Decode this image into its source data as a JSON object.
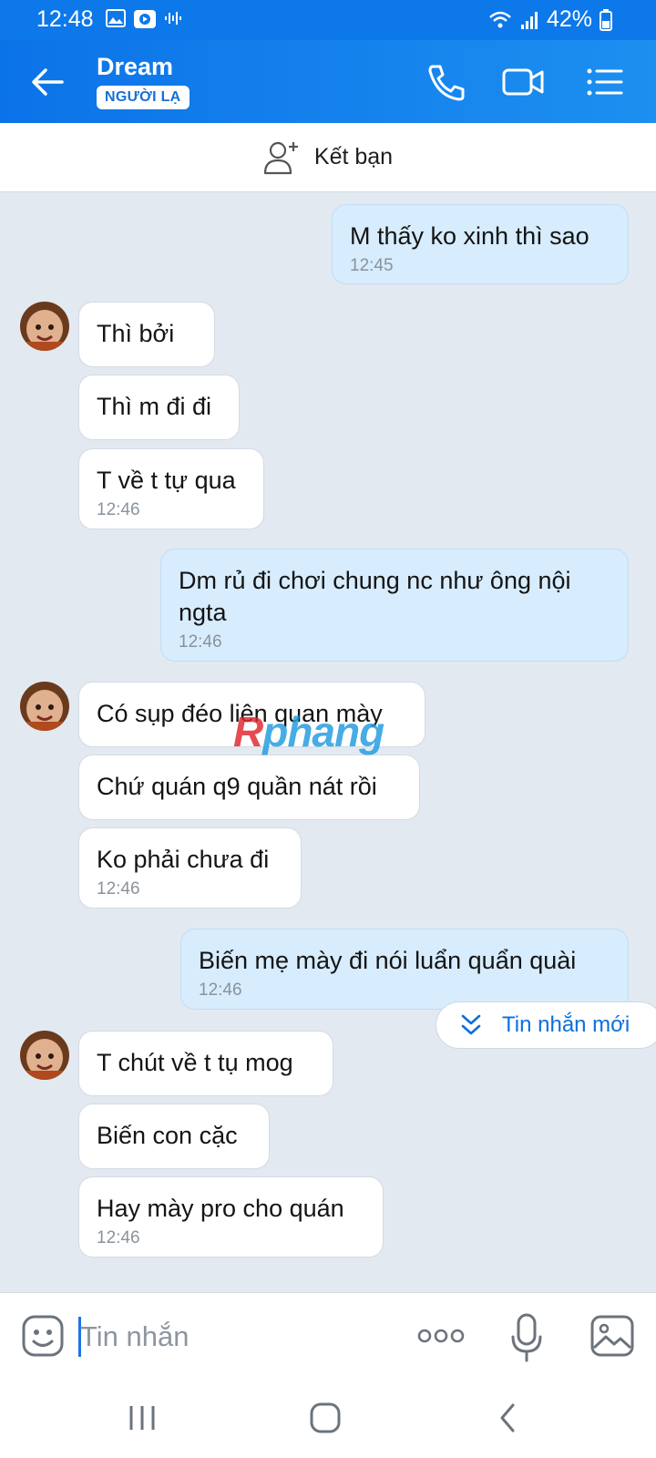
{
  "status": {
    "time": "12:48",
    "battery": "42%"
  },
  "header": {
    "name": "Dream",
    "badge": "NGƯỜI LẠ"
  },
  "add_friend": {
    "label": "Kết bạn"
  },
  "watermark": {
    "part1": "R",
    "part2": "phang"
  },
  "messages": [
    {
      "dir": "out",
      "text": "M thấy ko xinh thì sao",
      "time": "12:45"
    },
    {
      "dir": "in",
      "text": "Thì bởi"
    },
    {
      "dir": "in",
      "text": "Thì m đi đi"
    },
    {
      "dir": "in",
      "text": "T về t tự qua",
      "time": "12:46"
    },
    {
      "dir": "out",
      "text": "Dm rủ đi chơi chung nc như ông nội ngta",
      "time": "12:46"
    },
    {
      "dir": "in",
      "text": "Có sụp đéo liên quan mày"
    },
    {
      "dir": "in",
      "text": "Chứ quán q9 quần nát rồi"
    },
    {
      "dir": "in",
      "text": "Ko phải chưa đi",
      "time": "12:46"
    },
    {
      "dir": "out",
      "text": "Biến mẹ mày đi nói luẩn quẩn quài",
      "time": "12:46"
    },
    {
      "dir": "in",
      "text": "T chút về t tụ mog"
    },
    {
      "dir": "in",
      "text": "Biến con cặc"
    },
    {
      "dir": "in",
      "text": "Hay mày pro cho quán",
      "time": "12:46"
    }
  ],
  "new_messages": {
    "label": "Tin nhắn mới"
  },
  "composer": {
    "placeholder": "Tin nhắn"
  },
  "colors": {
    "header_blue": "#0b73e8",
    "outgoing_bubble": "#d7ecfd",
    "chat_bg": "#e2e9f1"
  }
}
